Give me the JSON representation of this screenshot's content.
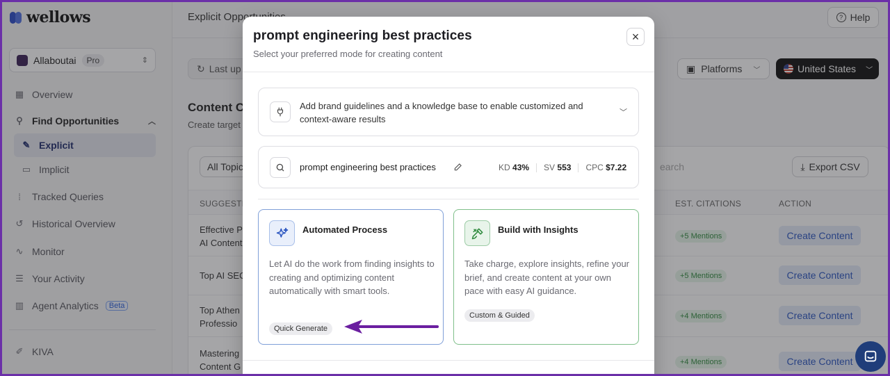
{
  "app": {
    "logo_text": "wellows",
    "workspace": {
      "name": "Allaboutai",
      "plan": "Pro"
    }
  },
  "sidebar": {
    "items": [
      {
        "label": "Overview",
        "icon": "grid-icon"
      },
      {
        "label": "Find Opportunities",
        "icon": "route-icon",
        "expanded": true
      },
      {
        "label": "Explicit",
        "icon": "edit-square-icon",
        "active": true
      },
      {
        "label": "Implicit",
        "icon": "chat-icon"
      },
      {
        "label": "Tracked Queries",
        "icon": "footprints-icon"
      },
      {
        "label": "Historical Overview",
        "icon": "history-icon"
      },
      {
        "label": "Monitor",
        "icon": "activity-icon"
      },
      {
        "label": "Your Activity",
        "icon": "list-icon"
      },
      {
        "label": "Agent Analytics",
        "icon": "bars-icon",
        "badge": "Beta"
      },
      {
        "label": "KIVA",
        "icon": "pen-icon"
      }
    ]
  },
  "header": {
    "title": "Explicit Opportunities",
    "help": "Help",
    "last_updated": "Last up",
    "platforms": "Platforms",
    "country": "United States"
  },
  "content": {
    "section_title": "Content C",
    "section_sub": "Create target",
    "filter": "All Topic",
    "search_placeholder": "earch",
    "export": "Export CSV",
    "columns": [
      "SUGGESTE",
      "EST. CITATIONS",
      "ACTION"
    ],
    "rows": [
      {
        "topic": [
          "Effective P",
          "AI Content"
        ],
        "mentions": "+5 Mentions",
        "action": "Create Content"
      },
      {
        "topic": [
          "Top AI SEO"
        ],
        "mentions": "+5 Mentions",
        "action": "Create Content"
      },
      {
        "topic": [
          "Top Athen",
          "Professio"
        ],
        "mentions": "+4 Mentions",
        "action": "Create Content"
      },
      {
        "topic": [
          "Mastering",
          "Content G"
        ],
        "mentions": "+4 Mentions",
        "action": "Create Content"
      }
    ]
  },
  "modal": {
    "title": "prompt engineering best practices",
    "subtitle": "Select your preferred mode for creating content",
    "close": "×",
    "brand_guidelines": "Add brand guidelines and a knowledge base to enable customized and context-aware results",
    "keyword": "prompt engineering best practices",
    "metrics": {
      "kd_label": "KD",
      "kd_value": "43%",
      "sv_label": "SV",
      "sv_value": "553",
      "cpc_label": "CPC",
      "cpc_value": "$7.22"
    },
    "modes": [
      {
        "title": "Automated Process",
        "description": "Let AI do the work from finding insights to creating and optimizing content automatically with smart tools.",
        "tag": "Quick Generate",
        "icon": "sparkles-icon",
        "accent": "#7f9fd8"
      },
      {
        "title": "Build with Insights",
        "description": "Take charge, explore insights, refine your brief, and create content at your own pace with easy AI guidance.",
        "tag": "Custom & Guided",
        "icon": "tools-icon",
        "accent": "#7fbf8a"
      }
    ]
  },
  "colors": {
    "frame": "#6b2fa8",
    "annotation_arrow": "#6b1fa0",
    "create_button_text": "#2a55c0",
    "mentions_text": "#2f8a3e"
  }
}
